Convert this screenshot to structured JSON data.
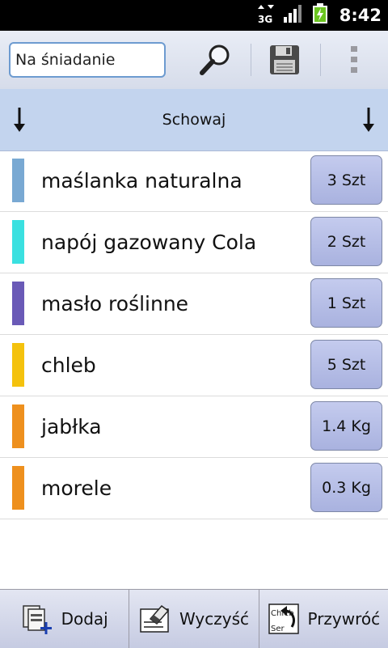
{
  "status": {
    "network": "3G",
    "time": "8:42"
  },
  "toolbar": {
    "list_name": "Na śniadanie",
    "search_icon": "magnifier-icon",
    "save_icon": "floppy-disk-icon",
    "menu_icon": "overflow-menu-icon"
  },
  "sortbar": {
    "title": "Schowaj"
  },
  "items": [
    {
      "name": "maślanka naturalna",
      "qty": "3 Szt",
      "color": "#79a9d3"
    },
    {
      "name": "napój gazowany Cola",
      "qty": "2 Szt",
      "color": "#3ae0e0"
    },
    {
      "name": "masło roślinne",
      "qty": "1 Szt",
      "color": "#6a5ab7"
    },
    {
      "name": "chleb",
      "qty": "5 Szt",
      "color": "#f4c20d"
    },
    {
      "name": "jabłka",
      "qty": "1.4 Kg",
      "color": "#ee901e"
    },
    {
      "name": "morele",
      "qty": "0.3 Kg",
      "color": "#ee901e"
    }
  ],
  "bottom": {
    "add_label": "Dodaj",
    "clear_label": "Wyczyść",
    "restore_label": "Przywróć",
    "restore_icon_text_top": "Chleb",
    "restore_icon_text_bottom": "Ser"
  }
}
